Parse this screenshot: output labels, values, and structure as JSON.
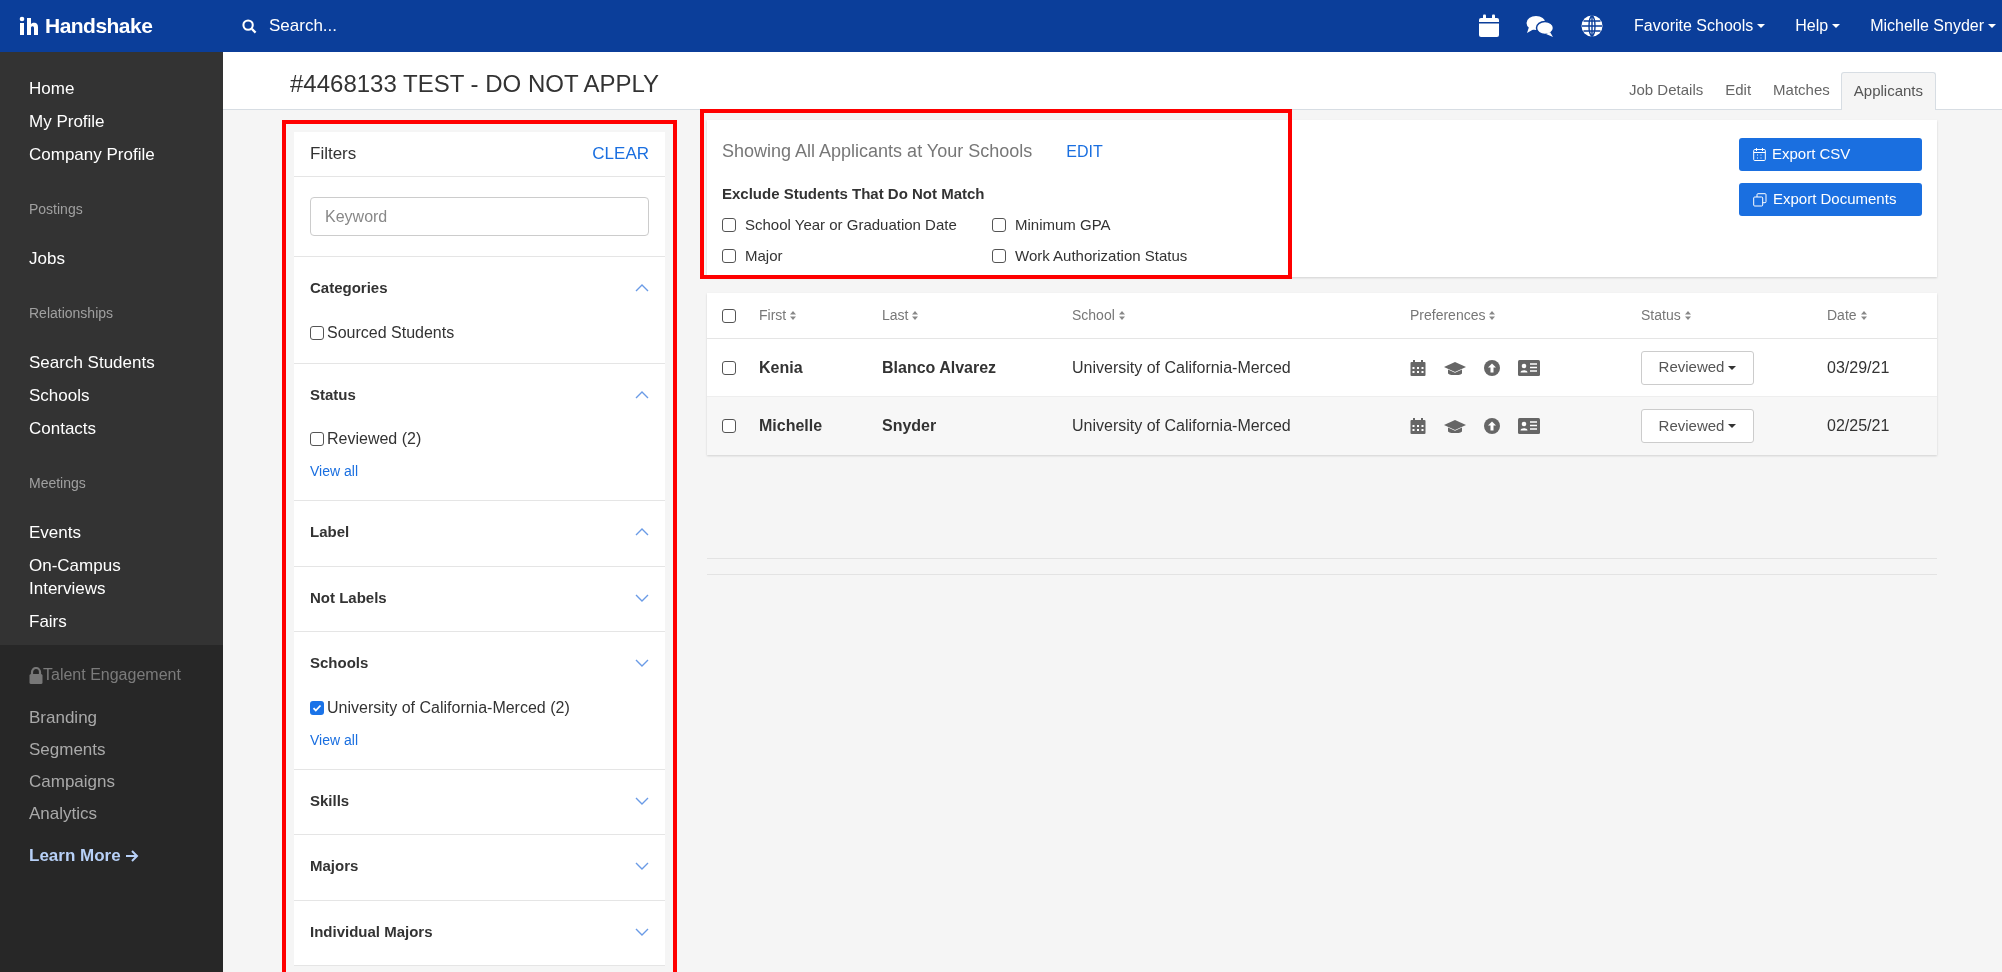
{
  "top_bar": {
    "logo": "Handshake",
    "search": {
      "placeholder": "Search..."
    },
    "menus": [
      "Favorite Schools",
      "Help",
      "Michelle Snyder"
    ]
  },
  "sidebar": {
    "sections": [
      {
        "items": [
          "Home",
          "My Profile",
          "Company Profile"
        ]
      },
      {
        "heading": "Postings",
        "items": [
          "Jobs"
        ]
      },
      {
        "heading": "Relationships",
        "items": [
          "Search Students",
          "Schools",
          "Contacts"
        ]
      },
      {
        "heading": "Meetings",
        "items": [
          "Events",
          "On-Campus Interviews",
          "Fairs"
        ]
      },
      {
        "heading": "Talent Engagement",
        "locked": true,
        "items": [
          "Branding",
          "Segments",
          "Campaigns",
          "Analytics"
        ]
      }
    ],
    "learn_more": "Learn More"
  },
  "page": {
    "title": "#4468133 TEST - DO NOT APPLY",
    "tabs": [
      {
        "label": "Job Details",
        "selected": false
      },
      {
        "label": "Edit",
        "selected": false
      },
      {
        "label": "Matches",
        "selected": false
      },
      {
        "label": "Applicants",
        "selected": true
      }
    ]
  },
  "filters": {
    "highlighted": true,
    "title": "Filters",
    "clear": "CLEAR",
    "keyword": {
      "placeholder": "Keyword"
    },
    "sections": [
      {
        "title": "Categories",
        "expanded": true,
        "options": [
          {
            "label": "Sourced Students",
            "checked": false
          }
        ]
      },
      {
        "title": "Status",
        "expanded": true,
        "options": [
          {
            "label": "Reviewed (2)",
            "checked": false
          }
        ],
        "view_all": "View all"
      },
      {
        "title": "Label",
        "expanded": true
      },
      {
        "title": "Not Labels",
        "expanded": false
      },
      {
        "title": "Schools",
        "expanded": false,
        "options": [
          {
            "label": "University of California-Merced (2)",
            "checked": true
          }
        ],
        "view_all": "View all"
      },
      {
        "title": "Skills",
        "expanded": false
      },
      {
        "title": "Majors",
        "expanded": false
      },
      {
        "title": "Individual Majors",
        "expanded": false
      }
    ]
  },
  "summary": {
    "highlighted": true,
    "heading": "Showing All Applicants at Your Schools",
    "edit": "EDIT",
    "exclude_title": "Exclude Students That Do Not Match",
    "exclude_options": [
      {
        "label": "School Year or Graduation Date",
        "checked": false
      },
      {
        "label": "Minimum GPA",
        "checked": false
      },
      {
        "label": "Major",
        "checked": false
      },
      {
        "label": "Work Authorization Status",
        "checked": false
      }
    ],
    "buttons": [
      {
        "label": "Export CSV",
        "kind": "calendar"
      },
      {
        "label": "Export Documents",
        "kind": "copy"
      }
    ]
  },
  "table": {
    "select_all": false,
    "columns": [
      "First",
      "Last",
      "School",
      "Preferences",
      "Status",
      "Date"
    ],
    "rows": [
      {
        "checked": false,
        "first": "Kenia",
        "last": "Blanco Alvarez",
        "school": "University of California-Merced",
        "status": "Reviewed",
        "date": "03/29/21"
      },
      {
        "checked": false,
        "first": "Michelle",
        "last": "Snyder",
        "school": "University of California-Merced",
        "status": "Reviewed",
        "date": "02/25/21"
      }
    ]
  }
}
